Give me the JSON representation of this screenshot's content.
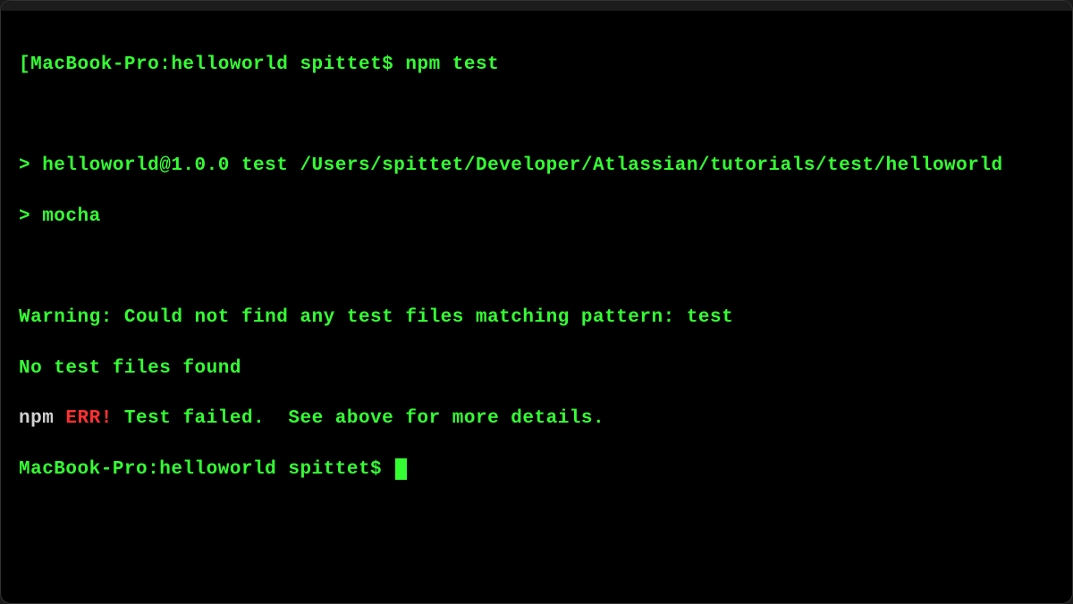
{
  "terminal": {
    "prompt1_bracket": "[",
    "prompt1_host": "MacBook-Pro:helloworld spittet$",
    "prompt1_command": " npm test",
    "script_line1": "> helloworld@1.0.0 test /Users/spittet/Developer/Atlassian/tutorials/test/helloworld",
    "script_line2": "> mocha",
    "warning_line": "Warning: Could not find any test files matching pattern: test",
    "notest_line": "No test files found",
    "npm_label": "npm",
    "err_label": " ERR!",
    "err_message": " Test failed.  See above for more details.",
    "prompt2": "MacBook-Pro:helloworld spittet$ "
  }
}
